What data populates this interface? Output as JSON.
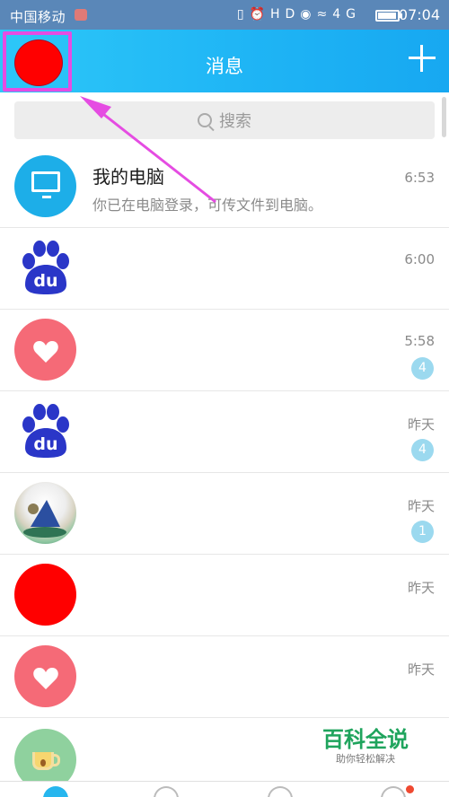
{
  "status": {
    "carrier": "中国移动",
    "time": "07:04",
    "icons": [
      "vibrate-icon",
      "alarm-icon",
      "hd-icon",
      "eye-icon",
      "wifi-icon",
      "4g-icon",
      "battery-icon"
    ],
    "hd": "HD",
    "network": "4G"
  },
  "header": {
    "title": "消息"
  },
  "search": {
    "placeholder": "搜索"
  },
  "messages": [
    {
      "title": "我的电脑",
      "subtitle": "你已在电脑登录，可传文件到电脑。",
      "time": "6:53",
      "badge": ""
    },
    {
      "title": "",
      "subtitle": "",
      "time": "6:00",
      "badge": ""
    },
    {
      "title": "",
      "subtitle": "",
      "time": "5:58",
      "badge": "4"
    },
    {
      "title": "",
      "subtitle": "",
      "time": "昨天",
      "badge": "4"
    },
    {
      "title": "",
      "subtitle": "",
      "time": "昨天",
      "badge": "1"
    },
    {
      "title": "",
      "subtitle": "",
      "time": "昨天",
      "badge": ""
    },
    {
      "title": "",
      "subtitle": "",
      "time": "昨天",
      "badge": ""
    },
    {
      "title": "",
      "subtitle": "",
      "time": "",
      "badge": ""
    }
  ],
  "watermark": {
    "main": "百科全说",
    "sub": "助你轻松解决"
  },
  "colors": {
    "header": "#1fb5f5",
    "statusbar": "#5a87b8",
    "annotation": "#e54ce2",
    "badge": "#9bd9ef",
    "watermark": "#1fa45d"
  }
}
